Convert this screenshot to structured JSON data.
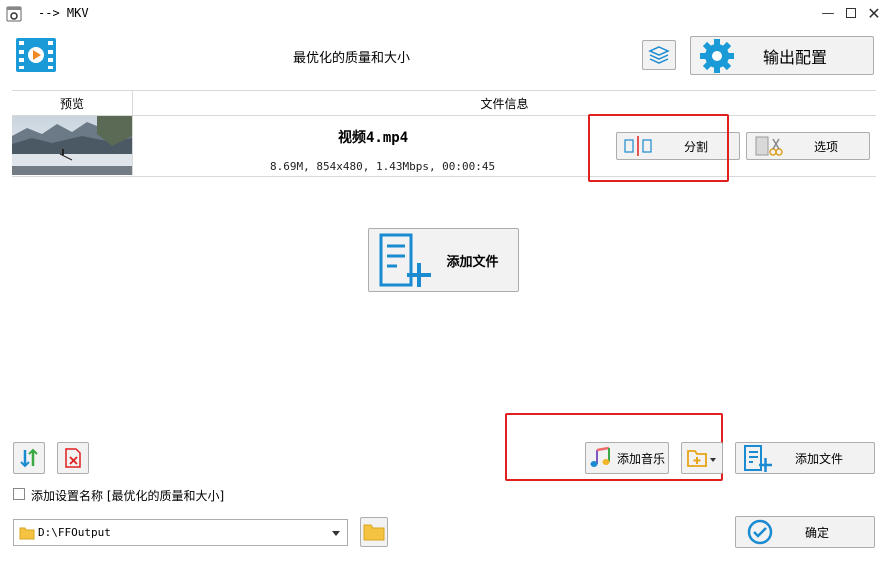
{
  "window": {
    "title": "--> MKV"
  },
  "header": {
    "preset": "最优化的质量和大小",
    "output_config": "输出配置"
  },
  "table": {
    "headers": [
      "预览",
      "文件信息"
    ],
    "rows": [
      {
        "filename": "视频4.mp4",
        "details": "8.69M, 854x480, 1.43Mbps, 00:00:45",
        "split_label": "分割",
        "options_label": "选项"
      }
    ]
  },
  "center": {
    "add_file": "添加文件"
  },
  "bottom": {
    "add_music": "添加音乐",
    "add_file": "添加文件",
    "checkbox_label": "添加设置名称 [最优化的质量和大小]",
    "checkbox_checked": false,
    "output_path": "D:\\FFOutput",
    "confirm": "确定"
  },
  "colors": {
    "accent": "#1a8ad1",
    "highlight": "#e0201e",
    "folder": "#f5c342"
  }
}
